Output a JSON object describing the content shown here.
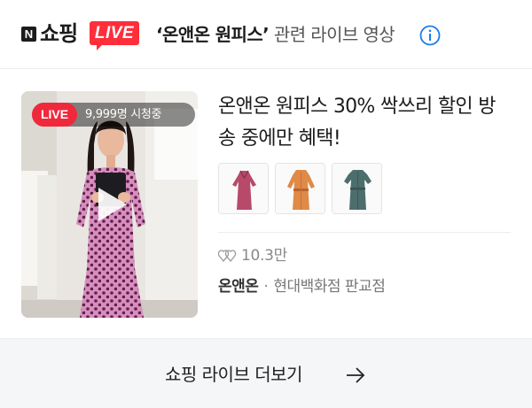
{
  "header": {
    "logo_mark": "N",
    "logo_word": "쇼핑",
    "logo_live": "LIVE",
    "query": "‘온앤온 원피스’",
    "suffix": " 관련 라이브 영상",
    "info_icon": "info-icon"
  },
  "card": {
    "live_badge": "LIVE",
    "viewers": "9,999명 시청중",
    "title": "온앤온 원피스 30% 싹쓰리 할인 방송 중에만 혜택!",
    "products": [
      {
        "name": "polka-dot-wrap-dress",
        "color": "#b74a6a"
      },
      {
        "name": "orange-belted-shirt-dress",
        "color": "#e08a48"
      },
      {
        "name": "teal-shirt-dress",
        "color": "#4c6e6c"
      }
    ],
    "likes": "10.3만",
    "brand": "온앤온",
    "dot": "·",
    "location": "현대백화점 판교점"
  },
  "footer": {
    "more_label": "쇼핑 라이브 더보기",
    "arrow_icon": "arrow-right-icon"
  },
  "colors": {
    "live_red": "#f0283c",
    "info_blue": "#1e7be6",
    "footer_bg": "#f4f6f8"
  }
}
